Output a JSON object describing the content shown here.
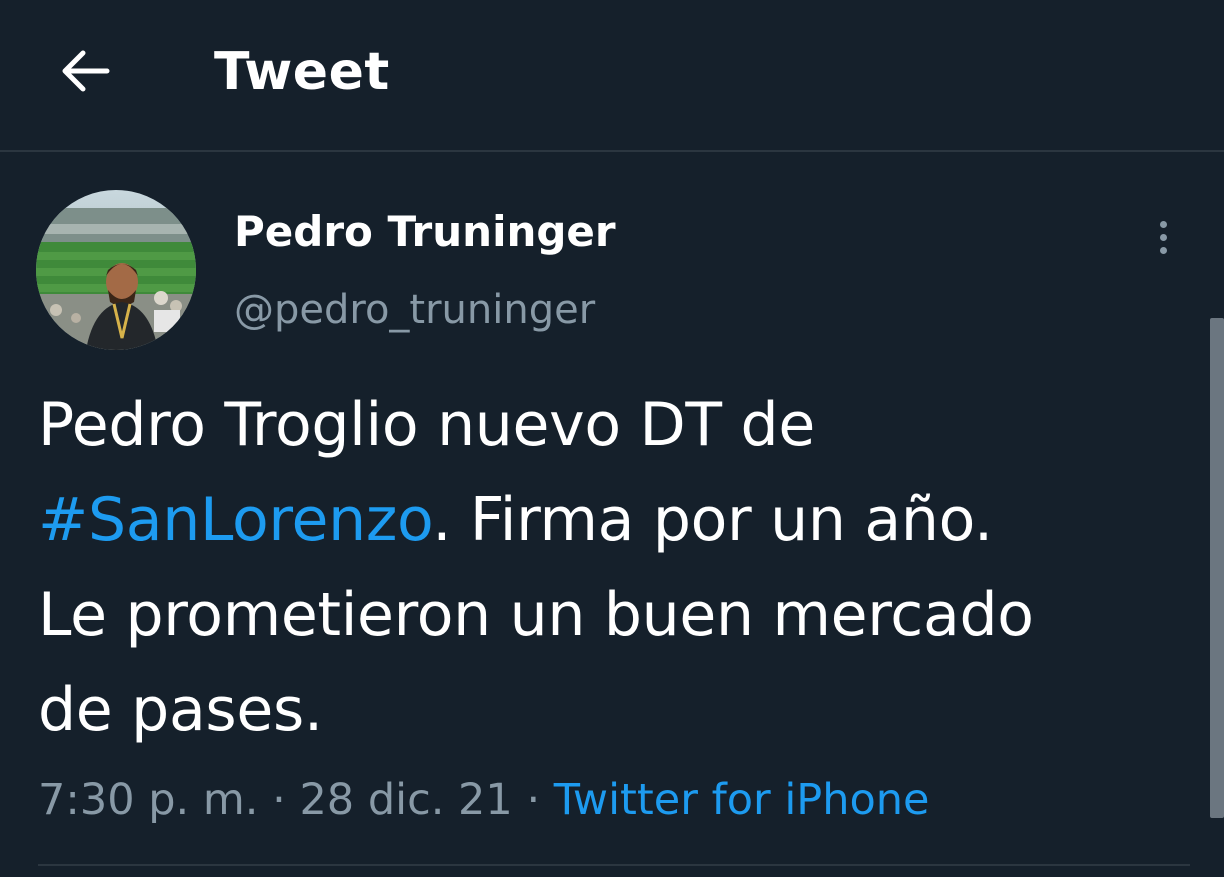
{
  "header": {
    "title": "Tweet",
    "back_icon": "arrow-left-icon"
  },
  "author": {
    "name": "Pedro Truninger",
    "handle": "@pedro_truninger",
    "avatar": "profile-photo-stadium"
  },
  "tweet": {
    "line1": "Pedro Troglio nuevo DT de",
    "hashtag": "#SanLorenzo",
    "line2_rest": ". Firma por un año.",
    "line3": "Le prometieron un buen mercado",
    "line4": "de pases."
  },
  "meta": {
    "time": "7:30 p. m.",
    "separator": "·",
    "date": "28 dic. 21",
    "source": "Twitter for iPhone"
  },
  "more_icon": "more-vertical-icon",
  "colors": {
    "background": "#15202b",
    "text": "#ffffff",
    "secondary": "#8899a6",
    "accent": "#1d9bf0"
  }
}
